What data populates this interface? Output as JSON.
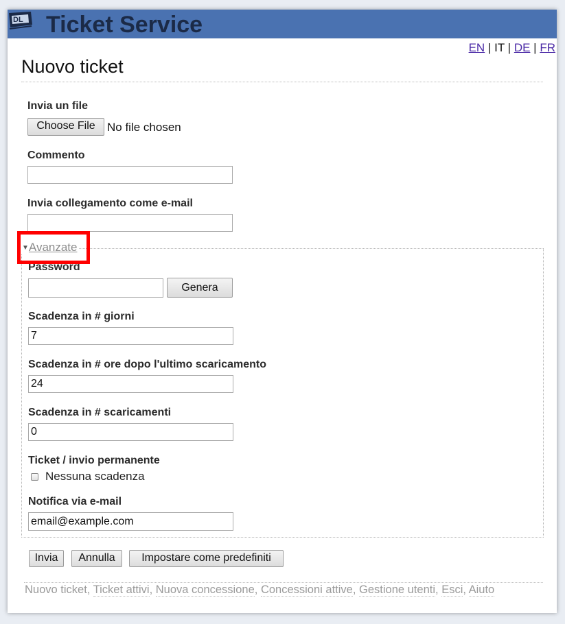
{
  "header": {
    "app_title": "Ticket Service",
    "logo_icon": "dl-logo-icon",
    "brand_color": "#4a72b1"
  },
  "languages": {
    "items": [
      {
        "code": "EN",
        "current": false
      },
      {
        "code": "IT",
        "current": true
      },
      {
        "code": "DE",
        "current": false
      },
      {
        "code": "FR",
        "current": false
      }
    ],
    "separator": "|"
  },
  "page": {
    "title": "Nuovo ticket"
  },
  "form": {
    "file": {
      "label": "Invia un file",
      "button": "Choose File",
      "status": "No file chosen"
    },
    "comment": {
      "label": "Commento",
      "value": ""
    },
    "email_link": {
      "label": "Invia collegamento come e-mail",
      "value": ""
    },
    "advanced": {
      "legend": "Avanzate",
      "password": {
        "label": "Password",
        "value": "",
        "generate_button": "Genera"
      },
      "expiry_days": {
        "label": "Scadenza in # giorni",
        "value": "7"
      },
      "expiry_hours": {
        "label": "Scadenza in # ore dopo l'ultimo scaricamento",
        "value": "24"
      },
      "expiry_downloads": {
        "label": "Scadenza in # scaricamenti",
        "value": "0"
      },
      "permanent": {
        "label": "Ticket / invio permanente",
        "checkbox_label": "Nessuna scadenza",
        "checked": false
      },
      "notify": {
        "label": "Notifica via e-mail",
        "value": "email@example.com"
      }
    },
    "actions": {
      "submit": "Invia",
      "cancel": "Annulla",
      "defaults": "Impostare come predefiniti"
    }
  },
  "footer": {
    "links": [
      "Nuovo ticket",
      "Ticket attivi",
      "Nuova concessione",
      "Concessioni attive",
      "Gestione utenti",
      "Esci",
      "Aiuto"
    ]
  },
  "highlight_color": "#ff0000"
}
